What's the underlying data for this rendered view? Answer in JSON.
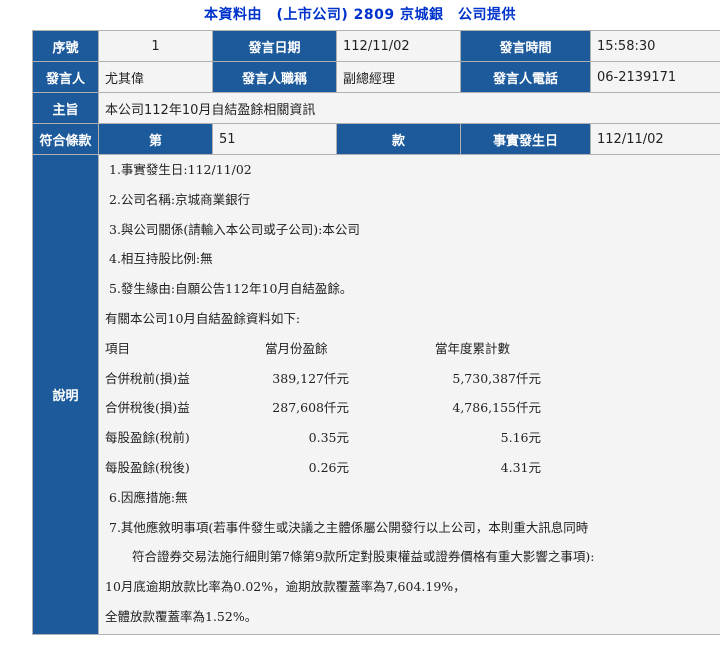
{
  "header": {
    "title": "本資料由　(上市公司) 2809 京城銀　公司提供"
  },
  "row1": {
    "seq_label": "序號",
    "seq_value": "1",
    "date_label": "發言日期",
    "date_value": "112/11/02",
    "time_label": "發言時間",
    "time_value": "15:58:30"
  },
  "row2": {
    "speaker_label": "發言人",
    "speaker_value": "尤其偉",
    "title_label": "發言人職稱",
    "title_value": "副總經理",
    "phone_label": "發言人電話",
    "phone_value": "06-2139171"
  },
  "row3": {
    "subject_label": "主旨",
    "subject_value": "本公司112年10月自結盈餘相關資訊"
  },
  "row4": {
    "clause_label": "符合條款",
    "di_label": "第",
    "clause_value": "51",
    "kuan_label": "款",
    "event_date_label": "事實發生日",
    "event_date_value": "112/11/02"
  },
  "description": {
    "label": "說明",
    "line1": "1.事實發生日:112/11/02",
    "line2": "2.公司名稱:京城商業銀行",
    "line3": "3.與公司關係(請輸入本公司或子公司):本公司",
    "line4": "4.相互持股比例:無",
    "line5": "5.發生緣由:自願公告112年10月自結盈餘。",
    "line6": "有關本公司10月自結盈餘資料如下:",
    "table_headers": [
      "項目",
      "當月份盈餘",
      "當年度累計數"
    ],
    "rows": [
      {
        "item": "合併稅前(損)益",
        "month": "389,127仟元",
        "ytd": "5,730,387仟元"
      },
      {
        "item": "合併稅後(損)益",
        "month": "287,608仟元",
        "ytd": "4,786,155仟元"
      },
      {
        "item": "每股盈餘(稅前)",
        "month": "0.35元",
        "ytd": "5.16元"
      },
      {
        "item": "每股盈餘(稅後)",
        "month": "0.26元",
        "ytd": "4.31元"
      }
    ],
    "line7": "6.因應措施:無",
    "line8": "7.其他應敘明事項(若事件發生或決議之主體係屬公開發行以上公司，本則重大訊息同時",
    "line9": "符合證券交易法施行細則第7條第9款所定對股東權益或證券價格有重大影響之事項):",
    "line10": "10月底逾期放款比率為0.02%，逾期放款覆蓋率為7,604.19%，",
    "line11": "全體放款覆蓋率為1.52%。"
  }
}
